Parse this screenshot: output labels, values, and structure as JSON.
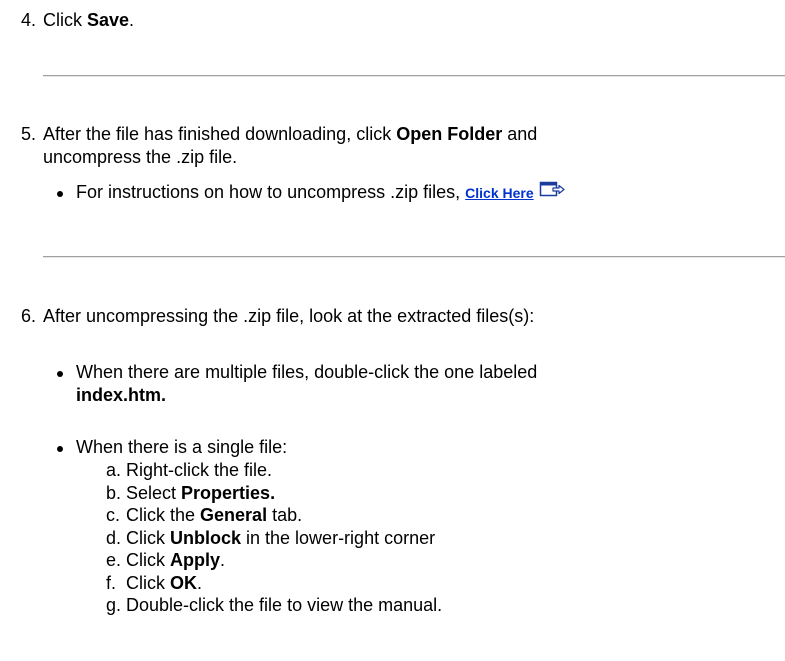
{
  "step4": {
    "num": "4.",
    "pre": "Click ",
    "bold": "Save",
    "post": "."
  },
  "step5": {
    "num": "5.",
    "pre": "After the file has finished downloading, click ",
    "bold": "Open Folder",
    "post": " and",
    "line2": "uncompress the .zip file.",
    "bullet_text": "For instructions on how to uncompress .zip files, ",
    "link_label": "Click Here",
    "link_icon": "external-window-arrow-icon"
  },
  "step6": {
    "num": "6.",
    "text": "After uncompressing the .zip file, look at the extracted files(s):",
    "bullet1_text": "When there are multiple files, double-click the one labeled",
    "bullet1_bold": "index.htm.",
    "bullet2_text": "When there is a single file:",
    "substeps": [
      {
        "letter": "a.",
        "pre": "Right-click the file.",
        "bold": "",
        "post": ""
      },
      {
        "letter": "b.",
        "pre": "Select ",
        "bold": "Properties.",
        "post": ""
      },
      {
        "letter": "c.",
        "pre": "Click the ",
        "bold": "General",
        "post": " tab."
      },
      {
        "letter": "d.",
        "pre": "Click ",
        "bold": "Unblock",
        "post": " in the lower-right corner"
      },
      {
        "letter": "e.",
        "pre": "Click ",
        "bold": "Apply",
        "post": "."
      },
      {
        "letter": "f.",
        "pre": "Click ",
        "bold": "OK",
        "post": "."
      },
      {
        "letter": "g.",
        "pre": "Double-click the file to view the manual.",
        "bold": "",
        "post": ""
      }
    ]
  }
}
